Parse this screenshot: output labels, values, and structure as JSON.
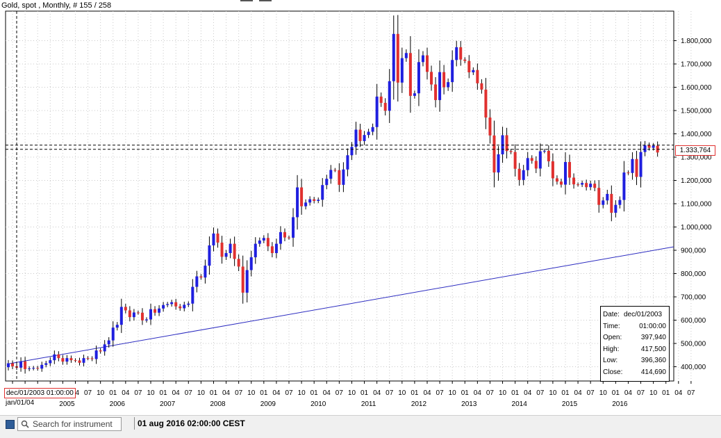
{
  "header": {
    "title": "Gold, spot , Monthly, # 155 / 258"
  },
  "chart_data": {
    "type": "candlestick",
    "interval": "Monthly",
    "ylim": [
      330000,
      1910000
    ],
    "y_ticks": [
      400000,
      500000,
      600000,
      700000,
      800000,
      900000,
      1000000,
      1100000,
      1200000,
      1300000,
      1400000,
      1500000,
      1600000,
      1700000,
      1800000
    ],
    "y_tick_labels": [
      "400,000",
      "500,000",
      "600,000",
      "700,000",
      "800,000",
      "900,000",
      "1.000,000",
      "1.100,000",
      "1.200,000",
      "1.300,000",
      "1.400,000",
      "1.500,000",
      "1.600,000",
      "1.700,000",
      "1.800,000"
    ],
    "x_tick_labels": [
      "01",
      "04",
      "07",
      "10",
      "01",
      "04",
      "07",
      "10",
      "01",
      "04",
      "07",
      "10",
      "01",
      "04",
      "07",
      "10",
      "01",
      "04",
      "07",
      "10",
      "01",
      "04",
      "07",
      "10",
      "01",
      "04",
      "07",
      "10",
      "01",
      "04",
      "07",
      "10",
      "01",
      "04",
      "07",
      "10",
      "01",
      "04",
      "07",
      "10",
      "01",
      "04",
      "07",
      "10",
      "01",
      "04",
      "07",
      "10",
      "01",
      "04",
      "07",
      "10",
      "01",
      "04",
      "07"
    ],
    "year_labels": [
      "jan/01/04",
      "2005",
      "2006",
      "2007",
      "2008",
      "2009",
      "2010",
      "2011",
      "2012",
      "2013",
      "2014",
      "2015",
      "2016"
    ],
    "grid": true,
    "current_price": 1333764,
    "current_price_label": "1.333,764",
    "trendline": {
      "start": [
        "2003-12",
        412000
      ],
      "end": [
        "2016-08",
        915000
      ]
    },
    "start_month": "2003-12",
    "closes": [
      414690,
      402000,
      396000,
      423000,
      390000,
      393000,
      395000,
      392000,
      408000,
      415000,
      428000,
      453000,
      437000,
      422000,
      437000,
      428000,
      427000,
      417000,
      437000,
      436000,
      433000,
      470000,
      466000,
      496000,
      513000,
      568000,
      580000,
      657000,
      642000,
      613000,
      633000,
      632000,
      599000,
      603000,
      647000,
      632000,
      650000,
      665000,
      669000,
      677000,
      659000,
      651000,
      666000,
      671000,
      743000,
      788000,
      783000,
      834000,
      921000,
      972000,
      933000,
      872000,
      888000,
      928000,
      863000,
      830000,
      718000,
      815000,
      870000,
      928000,
      942000,
      953000,
      917000,
      888000,
      928000,
      978000,
      955000,
      954000,
      1042000,
      1170000,
      1089000,
      1105000,
      1119000,
      1112000,
      1117000,
      1180000,
      1207000,
      1245000,
      1244000,
      1181000,
      1247000,
      1308000,
      1344000,
      1418000,
      1369000,
      1395000,
      1409000,
      1429000,
      1560000,
      1533000,
      1499000,
      1626000,
      1829000,
      1620000,
      1725000,
      1747000,
      1563000,
      1574000,
      1708000,
      1737000,
      1666000,
      1612000,
      1545000,
      1665000,
      1600000,
      1622000,
      1717000,
      1772000,
      1719000,
      1713000,
      1664000,
      1674000,
      1617000,
      1590000,
      1470000,
      1393000,
      1234000,
      1312000,
      1394000,
      1326000,
      1322000,
      1250000,
      1202000,
      1244000,
      1296000,
      1284000,
      1251000,
      1325000,
      1327000,
      1282000,
      1209000,
      1195000,
      1182000,
      1279000,
      1212000,
      1183000,
      1182000,
      1189000,
      1171000,
      1186000,
      1168000,
      1095000,
      1114000,
      1142000,
      1061000,
      1095000,
      1116000,
      1234000,
      1232000,
      1292000,
      1215000,
      1322000,
      1351000,
      1340000,
      1349000,
      1320000
    ],
    "info": {
      "Date": "dec/01/2003",
      "Time": "01:00:00",
      "Open": "397,940",
      "High": "417,500",
      "Low": "396,360",
      "Close": "414,690"
    },
    "cursor": {
      "date": "dec/01/2003 01:00:00",
      "sub": "jan/01/04"
    }
  },
  "info_labels": {
    "date": "Date:",
    "time": "Time:",
    "open": "Open:",
    "high": "High:",
    "low": "Low:",
    "close": "Close:"
  },
  "colors": {
    "up": "#1f1fdf",
    "down": "#e0302f",
    "trendline": "#2b2bc0",
    "grid": "#c8c8c8"
  },
  "bottom_bar": {
    "search_placeholder": "Search for instrument",
    "status_time": "01 aug 2016 02:00:00 CEST"
  }
}
